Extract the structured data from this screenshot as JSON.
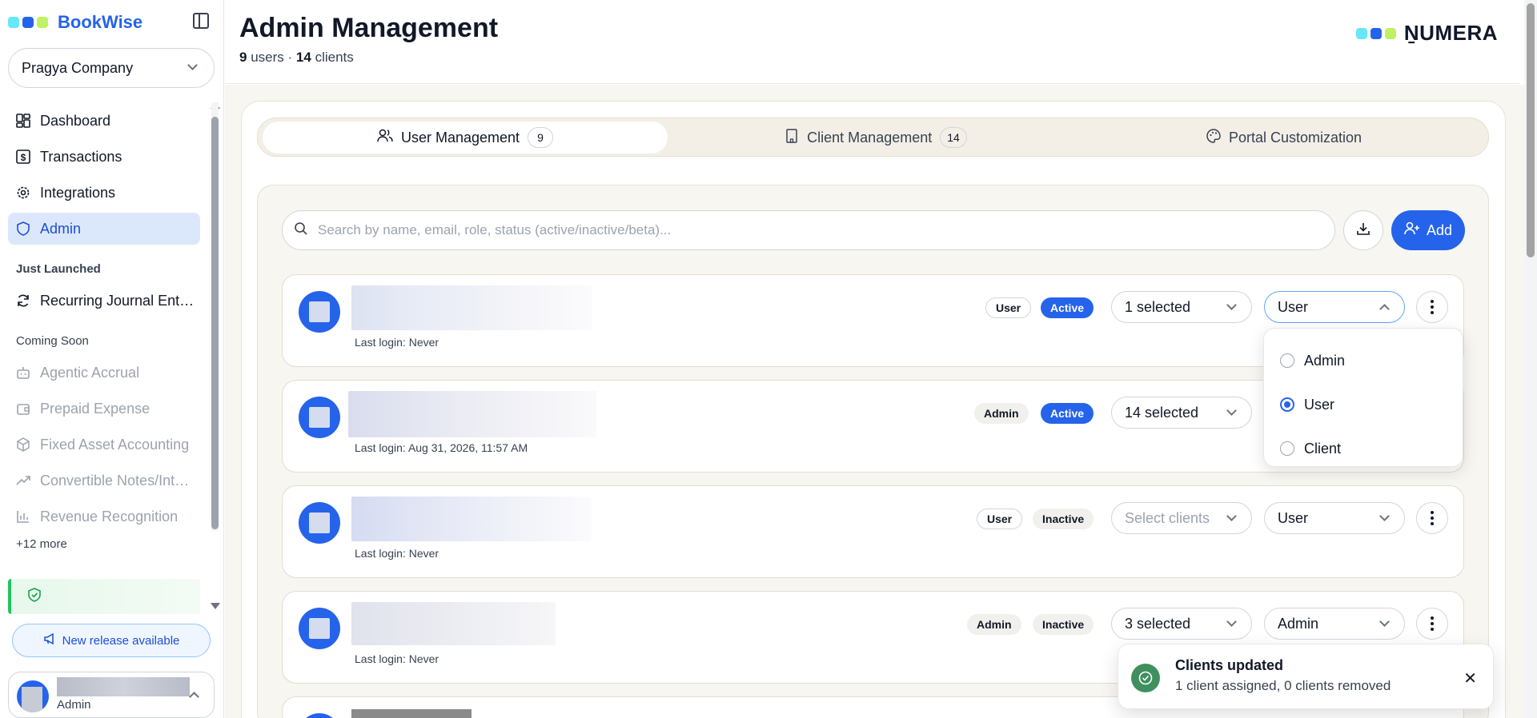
{
  "brand": {
    "name": "BookWise",
    "dot_colors": [
      "#67e8f9",
      "#2563eb",
      "#bef264"
    ]
  },
  "company": {
    "name": "Pragya Company"
  },
  "nav": {
    "items": [
      {
        "label": "Dashboard",
        "icon": "dashboard-icon"
      },
      {
        "label": "Transactions",
        "icon": "dollar-icon"
      },
      {
        "label": "Integrations",
        "icon": "gear-icon"
      },
      {
        "label": "Admin",
        "icon": "shield-icon",
        "active": true
      }
    ],
    "just_launched_label": "Just Launched",
    "just_launched": [
      {
        "label": "Recurring Journal Ent…",
        "icon": "refresh-icon"
      }
    ],
    "coming_soon_label": "Coming Soon",
    "coming_soon": [
      {
        "label": "Agentic Accrual",
        "icon": "bot-icon"
      },
      {
        "label": "Prepaid Expense",
        "icon": "wallet-icon"
      },
      {
        "label": "Fixed Asset Accounting",
        "icon": "box-icon"
      },
      {
        "label": "Convertible Notes/Int…",
        "icon": "trend-icon"
      },
      {
        "label": "Revenue Recognition",
        "icon": "bar-chart-icon"
      }
    ],
    "more": "+12 more"
  },
  "release": {
    "label": "New release available"
  },
  "current_user": {
    "role": "Admin"
  },
  "header": {
    "title": "Admin Management",
    "users_count": "9",
    "users_label": "users",
    "separator": "·",
    "clients_count": "14",
    "clients_label": "clients",
    "logo_text": "ṈUMERA"
  },
  "tabs": [
    {
      "label": "User Management",
      "count": "9",
      "icon": "users-icon",
      "active": true
    },
    {
      "label": "Client Management",
      "count": "14",
      "icon": "building-icon"
    },
    {
      "label": "Portal Customization",
      "icon": "palette-icon"
    }
  ],
  "search": {
    "placeholder": "Search by name, email, role, status (active/inactive/beta)..."
  },
  "actions": {
    "add_label": "Add"
  },
  "rows": [
    {
      "role_badge": "User",
      "status": "Active",
      "clients": "1 selected",
      "role_select": "User",
      "last_login": "Last login: Never"
    },
    {
      "role_badge": "Admin",
      "status": "Active",
      "clients": "14 selected",
      "role_select": "",
      "last_login": "Last login: Aug 31, 2026, 11:57 AM"
    },
    {
      "role_badge": "User",
      "status": "Inactive",
      "clients": "Select clients",
      "role_select": "User",
      "last_login": "Last login: Never"
    },
    {
      "role_badge": "Admin",
      "status": "Inactive",
      "clients": "3 selected",
      "role_select": "Admin",
      "last_login": "Last login: Never"
    }
  ],
  "role_menu": {
    "options": [
      "Admin",
      "User",
      "Client"
    ],
    "selected": "User"
  },
  "toast": {
    "title": "Clients updated",
    "message": "1 client assigned, 0 clients removed"
  },
  "colors": {
    "accent": "#2563eb",
    "success": "#3f8f5f",
    "page_bg": "#f8f6f1"
  }
}
